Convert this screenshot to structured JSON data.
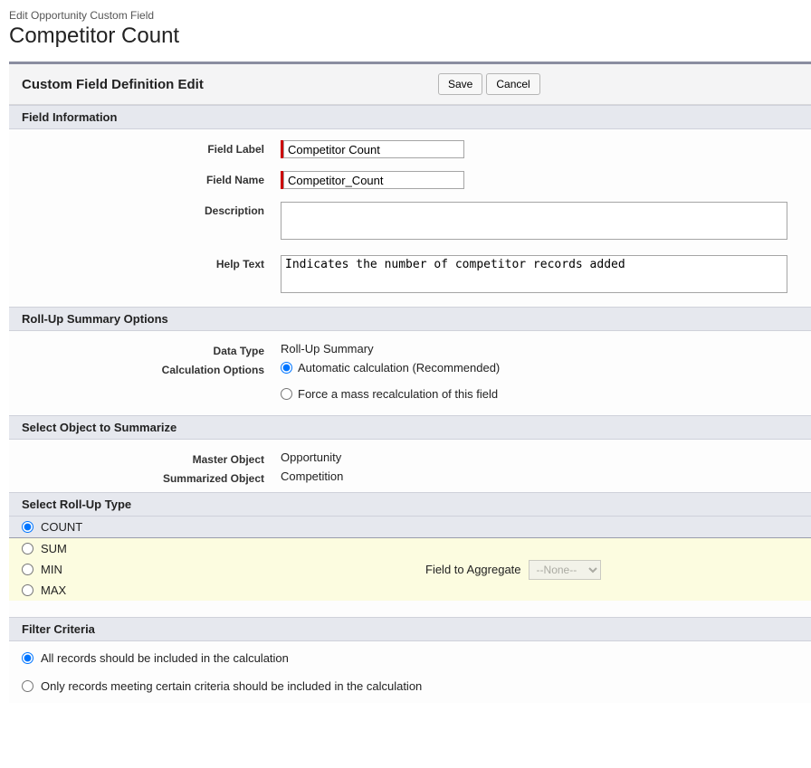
{
  "header": {
    "subtitle": "Edit Opportunity Custom Field",
    "title": "Competitor Count"
  },
  "panel": {
    "title": "Custom Field Definition Edit",
    "save_label": "Save",
    "cancel_label": "Cancel"
  },
  "sections": {
    "field_info": {
      "heading": "Field Information",
      "labels": {
        "field_label": "Field Label",
        "field_name": "Field Name",
        "description": "Description",
        "help_text": "Help Text"
      },
      "values": {
        "field_label": "Competitor Count",
        "field_name": "Competitor_Count",
        "description": "",
        "help_text": "Indicates the number of competitor records added"
      }
    },
    "rollup_options": {
      "heading": "Roll-Up Summary Options",
      "labels": {
        "data_type": "Data Type",
        "calc_options": "Calculation Options"
      },
      "values": {
        "data_type": "Roll-Up Summary"
      },
      "radios": {
        "auto": "Automatic calculation (Recommended)",
        "force": "Force a mass recalculation of this field"
      }
    },
    "summarize": {
      "heading": "Select Object to Summarize",
      "labels": {
        "master": "Master Object",
        "summarized": "Summarized Object"
      },
      "values": {
        "master": "Opportunity",
        "summarized": "Competition"
      }
    },
    "rollup_type": {
      "heading": "Select Roll-Up Type",
      "options": {
        "count": "COUNT",
        "sum": "SUM",
        "min": "MIN",
        "max": "MAX"
      },
      "agg_label": "Field to Aggregate",
      "agg_value": "--None--"
    },
    "filter": {
      "heading": "Filter Criteria",
      "all": "All records should be included in the calculation",
      "only": "Only records meeting certain criteria should be included in the calculation"
    }
  }
}
